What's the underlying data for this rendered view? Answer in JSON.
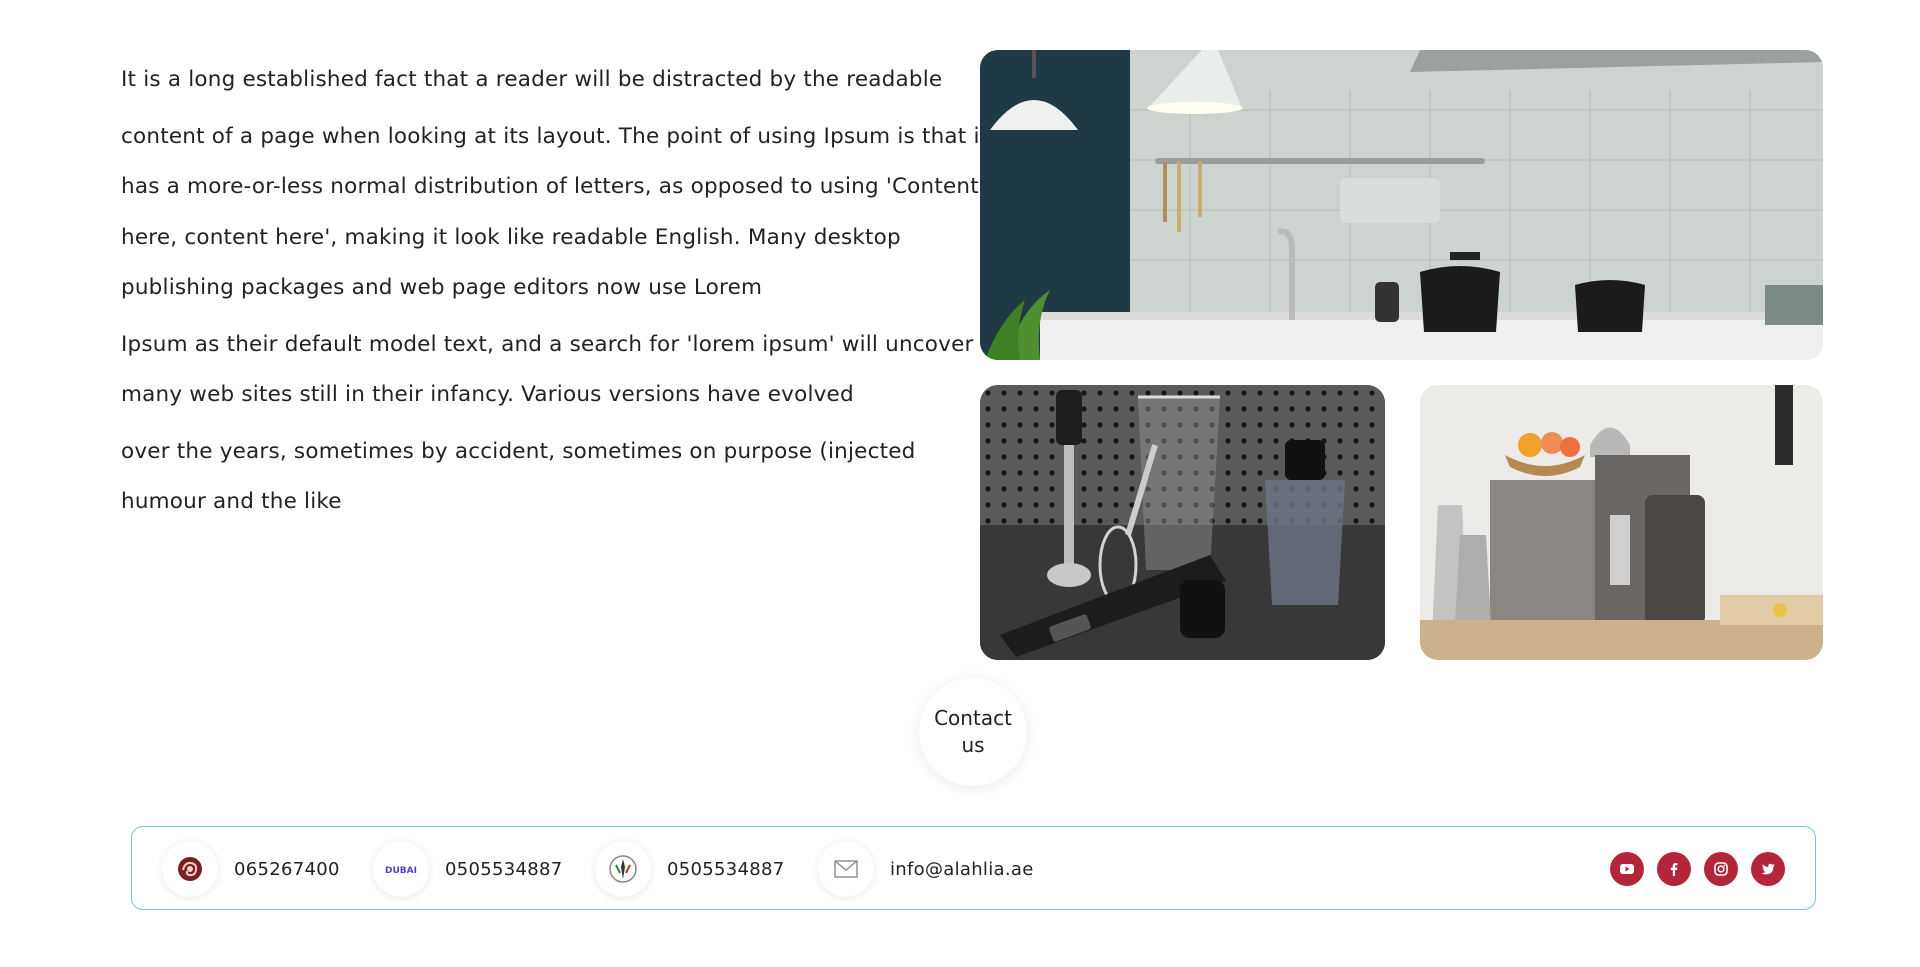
{
  "body_text": {
    "lines": [
      "It is a long established fact that a reader will be distracted by the readable",
      "content of a page when looking at its layout. The point of using Ipsum is that it",
      "has a more-or-less normal distribution of letters, as opposed to using 'Content",
      "here, content here', making it look like readable English. Many desktop",
      "publishing packages and web page editors now use Lorem",
      "Ipsum as their default model text, and a search for 'lorem ipsum' will uncover",
      "many web sites still in their infancy. Various versions have evolved",
      "over the years, sometimes by accident, sometimes on purpose (injected",
      "humour and the like"
    ]
  },
  "gallery": {
    "images": [
      {
        "subject": "kitchen-interior"
      },
      {
        "subject": "hand-blender-set"
      },
      {
        "subject": "coffee-machines"
      }
    ]
  },
  "contact": {
    "label": "Contact us"
  },
  "footer": {
    "items": [
      {
        "icon": "brand-logo-icon",
        "text": "065267400"
      },
      {
        "icon": "dubai-logo-icon",
        "text": "0505534887",
        "logo_text": "DUBAI"
      },
      {
        "icon": "emblem-logo-icon",
        "text": "0505534887"
      },
      {
        "icon": "mail-icon",
        "text": "info@alahlia.ae"
      }
    ],
    "socials": [
      {
        "name": "youtube-icon"
      },
      {
        "name": "facebook-icon"
      },
      {
        "name": "instagram-icon"
      },
      {
        "name": "twitter-icon"
      }
    ],
    "colors": {
      "accent": "#b3263a",
      "border": "#7cc3d8"
    }
  }
}
